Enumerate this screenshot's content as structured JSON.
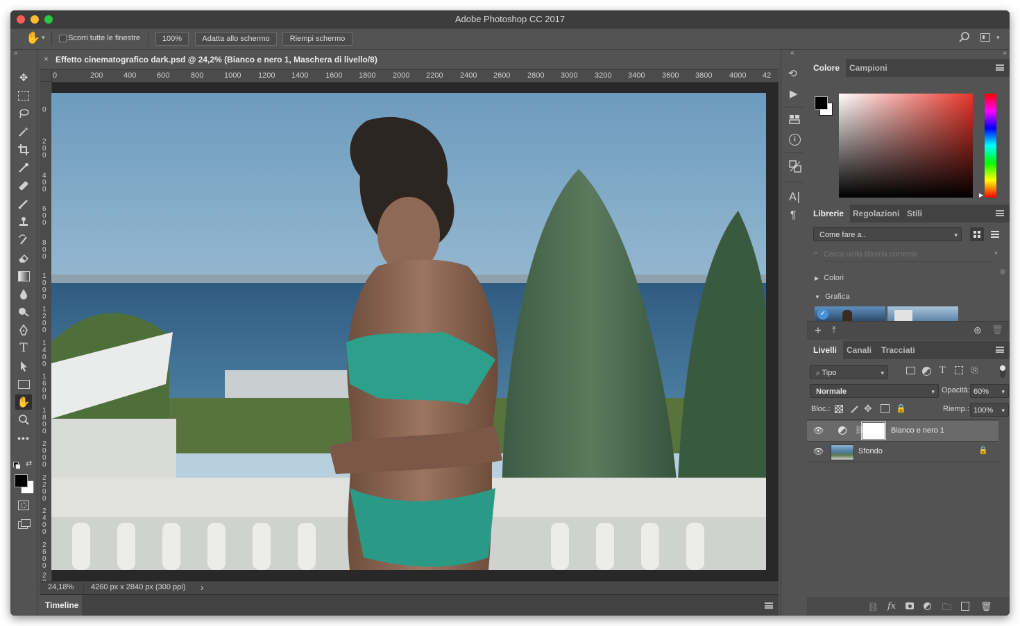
{
  "app": {
    "title": "Adobe Photoshop CC 2017",
    "traffic_colors": [
      "#fe5f57",
      "#febc2e",
      "#28c840"
    ]
  },
  "options_bar": {
    "scroll_all_label": "Scorri tutte le finestre",
    "zoom_value": "100%",
    "fit_screen_label": "Adatta allo schermo",
    "fill_screen_label": "Riempi schermo"
  },
  "document": {
    "tab_title": "Effetto cinematografico dark.psd @ 24,2% (Bianco e nero 1, Maschera di livello/8)",
    "ruler_h": [
      "0",
      "200",
      "400",
      "600",
      "800",
      "1000",
      "1200",
      "1400",
      "1600",
      "1800",
      "2000",
      "2200",
      "2400",
      "2600",
      "2800",
      "3000",
      "3200",
      "3400",
      "3600",
      "3800",
      "4000",
      "42"
    ],
    "ruler_v": [
      "0",
      "200",
      "400",
      "600",
      "800",
      "1000",
      "1200",
      "1400",
      "1600",
      "1800",
      "2000",
      "2200",
      "2400",
      "2600",
      "28"
    ],
    "zoom": "24,18%",
    "dimensions": "4260 px x 2840 px (300 ppi)",
    "status_arrow": "›"
  },
  "timeline": {
    "label": "Timeline"
  },
  "color_panel": {
    "tabs": [
      "Colore",
      "Campioni"
    ],
    "active_tab": "Colore",
    "foreground": "#000000",
    "background": "#ffffff",
    "hue_color": "#e8352a"
  },
  "libraries_panel": {
    "tabs": [
      "Librerie",
      "Regolazioni",
      "Stili"
    ],
    "active_tab": "Librerie",
    "library_select": "Come fare a..",
    "search_placeholder": "Cerca nella libreria corrente",
    "sections": [
      "Colori",
      "Grafica"
    ]
  },
  "layers_panel": {
    "tabs": [
      "Livelli",
      "Canali",
      "Tracciati"
    ],
    "active_tab": "Livelli",
    "filter_kind": "Tipo",
    "blend_mode": "Normale",
    "opacity_label": "Opacità:",
    "opacity_value": "60%",
    "lock_label": "Bloc.:",
    "fill_label": "Riemp.:",
    "fill_value": "100%",
    "layers": [
      {
        "name": "Bianco e nero 1",
        "selected": true,
        "visible": true
      },
      {
        "name": "Sfondo",
        "selected": false,
        "visible": true,
        "locked": true
      }
    ]
  }
}
